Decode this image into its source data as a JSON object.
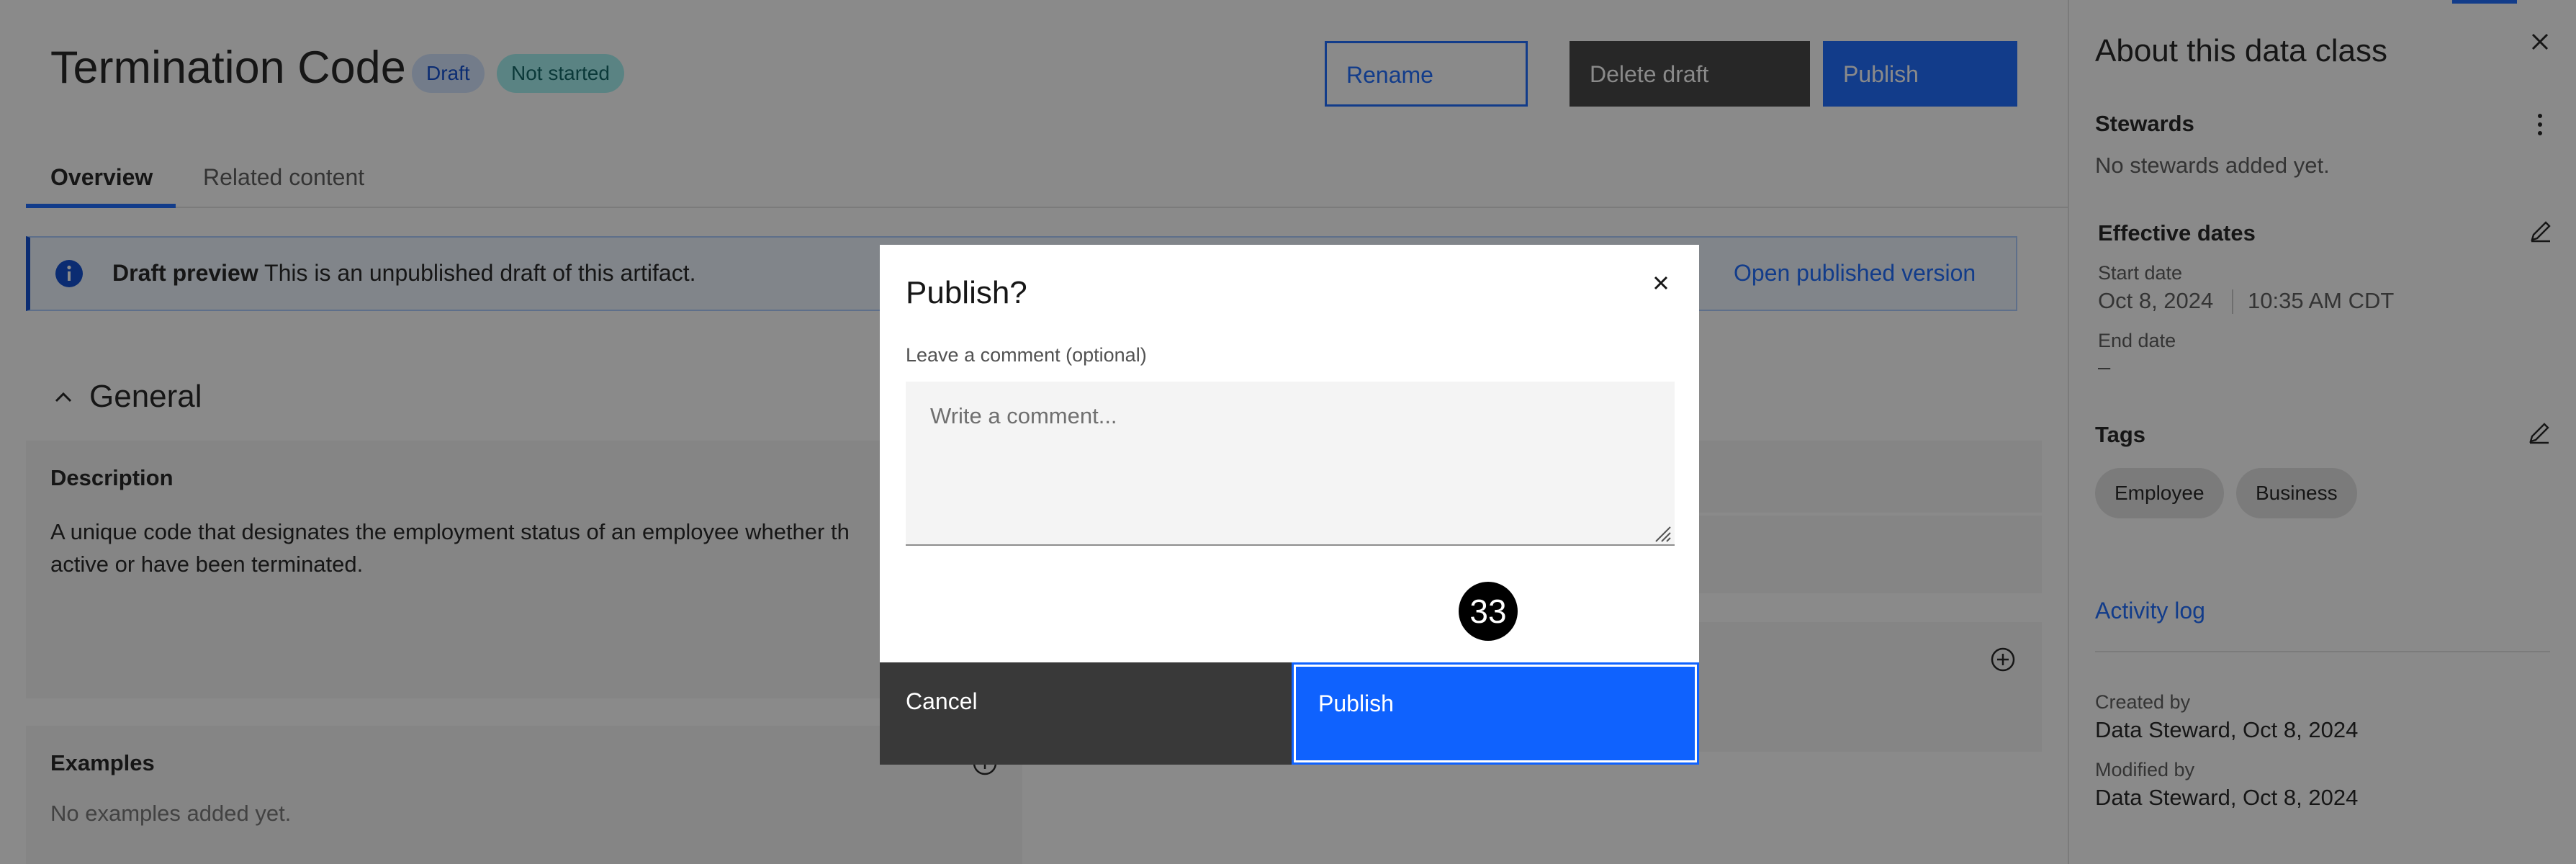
{
  "artifact": {
    "title": "Termination Code",
    "status_tags": [
      "Draft",
      "Not started"
    ]
  },
  "actions": {
    "rename": "Rename",
    "delete_draft": "Delete draft",
    "publish": "Publish"
  },
  "tabs": [
    {
      "label": "Overview",
      "selected": true
    },
    {
      "label": "Related content",
      "selected": false
    }
  ],
  "notification": {
    "title": "Draft preview",
    "message": "This is an unpublished draft of this artifact.",
    "link": "Open published version",
    "icon": "info-icon"
  },
  "general": {
    "heading": "General",
    "description_label": "Description",
    "description_text": "A unique code that designates the employment status of an employee whether th active or have been terminated.",
    "examples_label": "Examples",
    "examples_empty": "No examples added yet."
  },
  "side_panel": {
    "title": "About this data class",
    "stewards": {
      "heading": "Stewards",
      "empty": "No stewards added yet."
    },
    "effective_dates": {
      "heading": "Effective dates",
      "start_label": "Start date",
      "start_date": "Oct 8, 2024",
      "start_time": "10:35 AM CDT",
      "end_label": "End date",
      "end_value": "–"
    },
    "tags": {
      "heading": "Tags",
      "items": [
        "Employee",
        "Business"
      ]
    },
    "activity_link": "Activity log",
    "created_label": "Created by",
    "created_value": "Data Steward, Oct 8, 2024",
    "modified_label": "Modified by",
    "modified_value": "Data Steward, Oct 8, 2024"
  },
  "modal": {
    "title": "Publish?",
    "comment_label": "Leave a comment (optional)",
    "comment_placeholder": "Write a comment...",
    "comment_value": "",
    "cancel": "Cancel",
    "publish": "Publish"
  },
  "step_badge": "33",
  "colors": {
    "primary": "#0f62fe",
    "dark_button": "#393939",
    "draft_tag_bg": "#d0e2ff",
    "not_started_tag_bg": "#9ef0f0"
  }
}
